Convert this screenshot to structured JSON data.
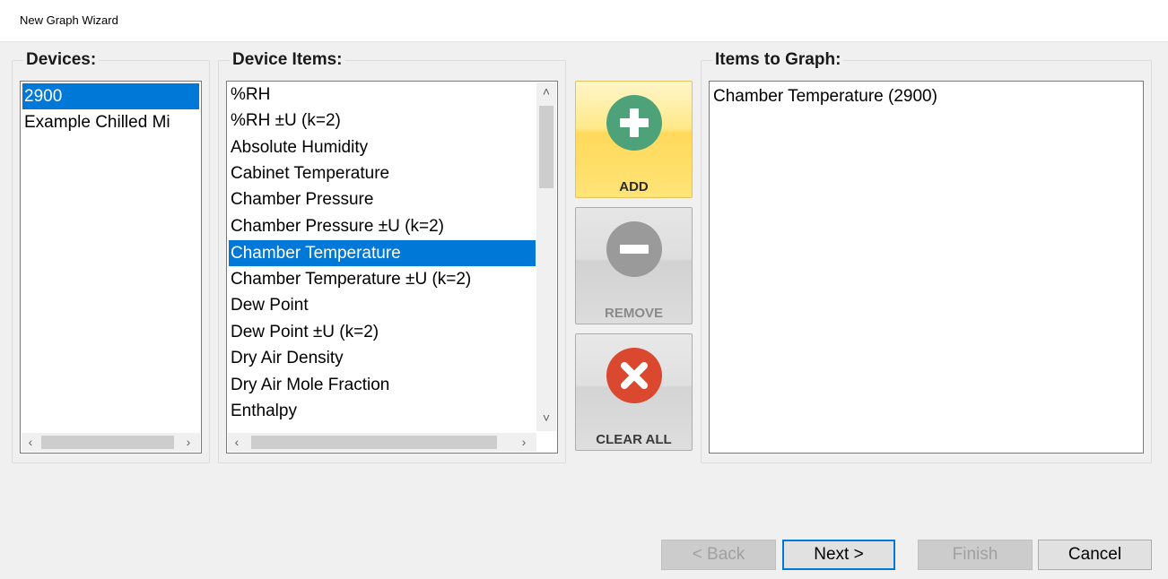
{
  "window": {
    "title": "New Graph Wizard"
  },
  "devices": {
    "label": "Devices:",
    "items": [
      "2900",
      "Example Chilled Mi"
    ],
    "selected_index": 0
  },
  "device_items": {
    "label": "Device Items:",
    "items": [
      "%RH",
      "%RH ±U (k=2)",
      "Absolute Humidity",
      "Cabinet Temperature",
      "Chamber Pressure",
      "Chamber Pressure ±U (k=2)",
      "Chamber Temperature",
      "Chamber Temperature ±U (k=2)",
      "Dew Point",
      "Dew Point ±U (k=2)",
      "Dry Air Density",
      "Dry Air Mole Fraction",
      "Enthalpy"
    ],
    "selected_index": 6
  },
  "items_to_graph": {
    "label": "Items to Graph:",
    "items": [
      "Chamber Temperature (2900)"
    ]
  },
  "actions": {
    "add_label": "ADD",
    "remove_label": "REMOVE",
    "clear_label": "CLEAR ALL"
  },
  "nav": {
    "back_label": "< Back",
    "next_label": "Next >",
    "finish_label": "Finish",
    "cancel_label": "Cancel"
  },
  "icons": {
    "add": "plus-circle-icon",
    "remove": "minus-circle-icon",
    "clear": "x-circle-icon",
    "scroll_up": "chevron-up-icon",
    "scroll_down": "chevron-down-icon",
    "scroll_left": "chevron-left-icon",
    "scroll_right": "chevron-right-icon"
  },
  "colors": {
    "selection": "#0078d7",
    "add_icon": "#4ea27a",
    "remove_icon": "#9a9a9a",
    "clear_icon": "#d9482f",
    "add_button": "#ffe477"
  }
}
